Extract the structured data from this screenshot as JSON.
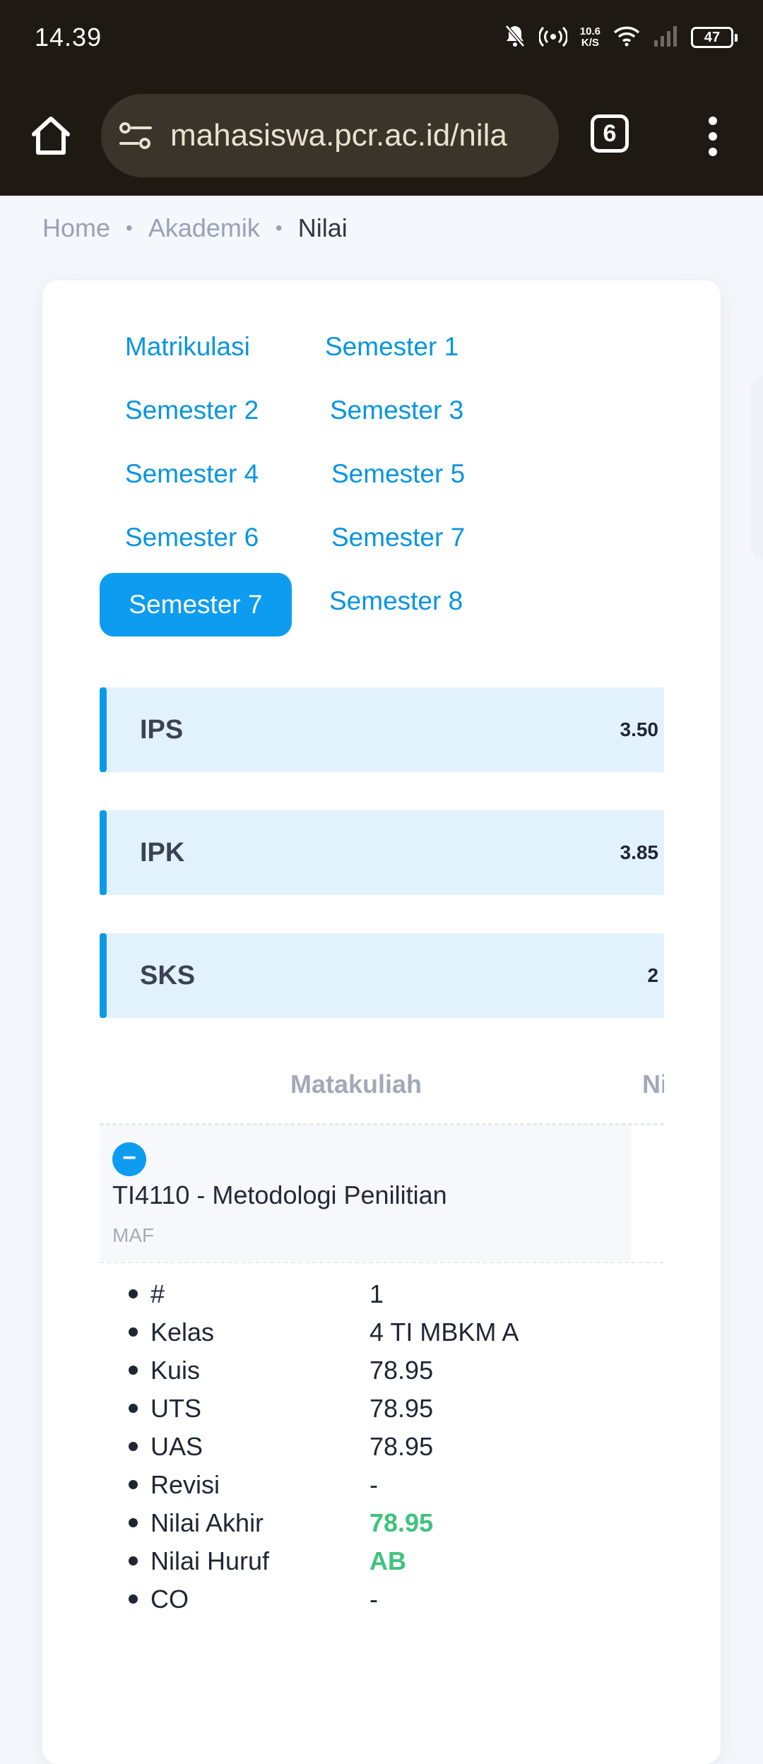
{
  "status_bar": {
    "time": "14.39",
    "net_speed_value": "10.6",
    "net_speed_unit": "K/S",
    "battery": "47"
  },
  "browser": {
    "url": "mahasiswa.pcr.ac.id/nila",
    "tab_count": "6"
  },
  "breadcrumb": {
    "items": [
      "Home",
      "Akademik",
      "Nilai"
    ]
  },
  "semesters": {
    "links": [
      "Matrikulasi",
      "Semester 1",
      "Semester 2",
      "Semester 3",
      "Semester 4",
      "Semester 5",
      "Semester 6",
      "Semester 7",
      "Semester 7",
      "Semester 8"
    ],
    "active_index": 8
  },
  "stats": [
    {
      "label": "IPS",
      "value": "3.50"
    },
    {
      "label": "IPK",
      "value": "3.85"
    },
    {
      "label": "SKS",
      "value": "2"
    }
  ],
  "table": {
    "headers": [
      "Matakuliah",
      "Ni"
    ],
    "course": {
      "toggle": "−",
      "name": "TI4110 - Metodologi Penilitian",
      "lecturer": "MAF"
    },
    "details": [
      {
        "key": "#",
        "value": "1"
      },
      {
        "key": "Kelas",
        "value": "4 TI MBKM A"
      },
      {
        "key": "Kuis",
        "value": "78.95"
      },
      {
        "key": "UTS",
        "value": "78.95"
      },
      {
        "key": "UAS",
        "value": "78.95"
      },
      {
        "key": "Revisi",
        "value": "-"
      },
      {
        "key": "Nilai Akhir",
        "value": "78.95"
      },
      {
        "key": "Nilai Huruf",
        "value": "AB"
      },
      {
        "key": "CO",
        "value": "-"
      }
    ]
  },
  "colors": {
    "accent": "#0d9cf0",
    "stat_bg": "#e2f2fc",
    "grade_green": "#3fc27e",
    "chrome_bg": "#1e1a13"
  },
  "icons": [
    "notification-off-icon",
    "hotspot-icon",
    "wifi-icon",
    "signal-icon",
    "battery-icon",
    "home-icon",
    "site-settings-icon",
    "more-vert-icon"
  ]
}
